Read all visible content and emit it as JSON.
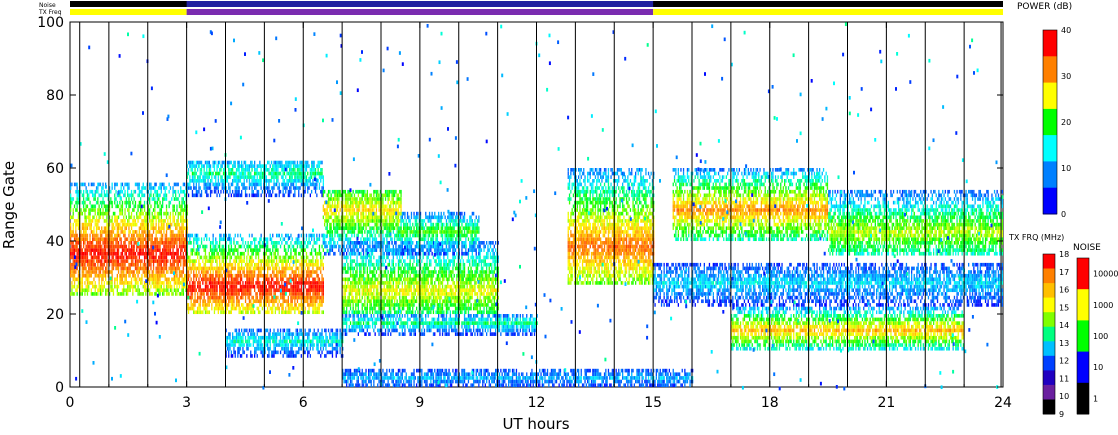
{
  "chart_data": {
    "type": "heatmap",
    "xlabel": "UT hours",
    "ylabel": "Range Gate",
    "xlim": [
      0,
      24
    ],
    "ylim": [
      0,
      100
    ],
    "xticks": [
      0,
      3,
      6,
      9,
      12,
      15,
      18,
      21,
      24
    ],
    "yticks": [
      0,
      20,
      40,
      60,
      80,
      100
    ],
    "scan_boundaries_hours": [
      0.25,
      1.0,
      2.0,
      3.0,
      4.0,
      5.0,
      6.0,
      7.0,
      8.0,
      9.0,
      10.0,
      11.0,
      12.0,
      13.0,
      14.0,
      15.0,
      16.0,
      17.0,
      18.0,
      19.0,
      20.0,
      21.0,
      22.0,
      23.0,
      23.95
    ],
    "top_bars": {
      "noise_label": "Noise",
      "txfreq_label": "TX Freq",
      "noise_color": "#2020a0",
      "txfreq_segments": [
        {
          "from": 0,
          "to": 3,
          "color": "#ffff00"
        },
        {
          "from": 3,
          "to": 15,
          "color": "#7a2cb0"
        },
        {
          "from": 15,
          "to": 24,
          "color": "#ffff00"
        }
      ]
    },
    "echo_bands": [
      {
        "t0": 0,
        "t1": 3,
        "g0": 25,
        "g1": 56,
        "peak": 36,
        "power_db": 38
      },
      {
        "t0": 3,
        "t1": 6.5,
        "g0": 20,
        "g1": 42,
        "peak": 27,
        "power_db": 38
      },
      {
        "t0": 3,
        "t1": 6.5,
        "g0": 52,
        "g1": 62,
        "peak": 58,
        "power_db": 14
      },
      {
        "t0": 4,
        "t1": 7,
        "g0": 8,
        "g1": 16,
        "peak": 12,
        "power_db": 12
      },
      {
        "t0": 6.5,
        "t1": 8.5,
        "g0": 36,
        "g1": 54,
        "peak": 48,
        "power_db": 26
      },
      {
        "t0": 7,
        "t1": 12,
        "g0": 14,
        "g1": 20,
        "peak": 17,
        "power_db": 14
      },
      {
        "t0": 7,
        "t1": 11,
        "g0": 20,
        "g1": 40,
        "peak": 26,
        "power_db": 24
      },
      {
        "t0": 8.5,
        "t1": 10.5,
        "g0": 36,
        "g1": 48,
        "peak": 42,
        "power_db": 18
      },
      {
        "t0": 12.8,
        "t1": 15,
        "g0": 28,
        "g1": 60,
        "peak": 38,
        "power_db": 32
      },
      {
        "t0": 15.5,
        "t1": 19.5,
        "g0": 40,
        "g1": 60,
        "peak": 48,
        "power_db": 30
      },
      {
        "t0": 17,
        "t1": 23,
        "g0": 10,
        "g1": 22,
        "peak": 15,
        "power_db": 28
      },
      {
        "t0": 19.5,
        "t1": 24,
        "g0": 36,
        "g1": 54,
        "peak": 42,
        "power_db": 22
      },
      {
        "t0": 15,
        "t1": 24,
        "g0": 22,
        "g1": 34,
        "peak": 28,
        "power_db": 10
      },
      {
        "t0": 7,
        "t1": 16,
        "g0": 0,
        "g1": 5,
        "peak": 2,
        "power_db": 8
      }
    ]
  },
  "colorbars": {
    "power": {
      "title": "POWER (dB)",
      "ticks": [
        "40",
        "30",
        "20",
        "10",
        "0"
      ],
      "colors": [
        "#ff0000",
        "#ff8000",
        "#ffff00",
        "#00ff00",
        "#00ffff",
        "#0080ff",
        "#0000ff"
      ]
    },
    "txfreq": {
      "title": "TX FRQ (MHz)",
      "ticks": [
        "18",
        "17",
        "16",
        "15",
        "14",
        "13",
        "12",
        "11",
        "10",
        "9"
      ],
      "colors": [
        "#ff0000",
        "#ff8000",
        "#ffbf00",
        "#ffff00",
        "#80ff00",
        "#00ff80",
        "#00c0ff",
        "#0040ff",
        "#2000c0",
        "#6a1f9f",
        "#000000"
      ]
    },
    "noise": {
      "title": "NOISE",
      "ticks": [
        "10000",
        "1000",
        "100",
        "10",
        "1"
      ],
      "colors": [
        "#ff0000",
        "#ffff00",
        "#00ff00",
        "#0000ff",
        "#000000"
      ]
    }
  }
}
